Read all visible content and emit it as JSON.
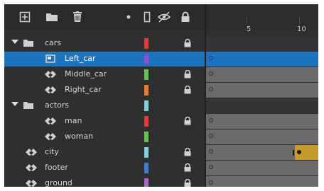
{
  "toolbar": {
    "icons": [
      "new-layer-icon",
      "new-folder-icon",
      "delete-layer-icon",
      "highlight-dot-icon",
      "outline-icon",
      "visibility-icon",
      "lock-icon"
    ]
  },
  "timeline": {
    "frame_numbers": [
      "5",
      "10"
    ]
  },
  "layers": [
    {
      "name": "cars",
      "type": "folder",
      "color": "#e03c3c",
      "locked": true,
      "expanded": true
    },
    {
      "name": "Left_car",
      "type": "layer",
      "color": "#8b4fcf",
      "locked": false,
      "selected": true
    },
    {
      "name": "Middle_car",
      "type": "layer",
      "color": "#63c34f",
      "locked": true
    },
    {
      "name": "Right_car",
      "type": "layer",
      "color": "#ee7b2a",
      "locked": true
    },
    {
      "name": "actors",
      "type": "folder",
      "color": "#7fd1e0",
      "locked": false,
      "expanded": true
    },
    {
      "name": "man",
      "type": "layer",
      "color": "#e03c3c",
      "locked": true
    },
    {
      "name": "woman",
      "type": "layer",
      "color": "#63c34f",
      "locked": false
    },
    {
      "name": "city",
      "type": "layer",
      "color": "#7fd1e0",
      "locked": true
    },
    {
      "name": "footer",
      "type": "layer",
      "color": "#3d7fd1",
      "locked": true
    },
    {
      "name": "ground",
      "type": "layer",
      "color": "#a86ac9",
      "locked": true
    }
  ]
}
